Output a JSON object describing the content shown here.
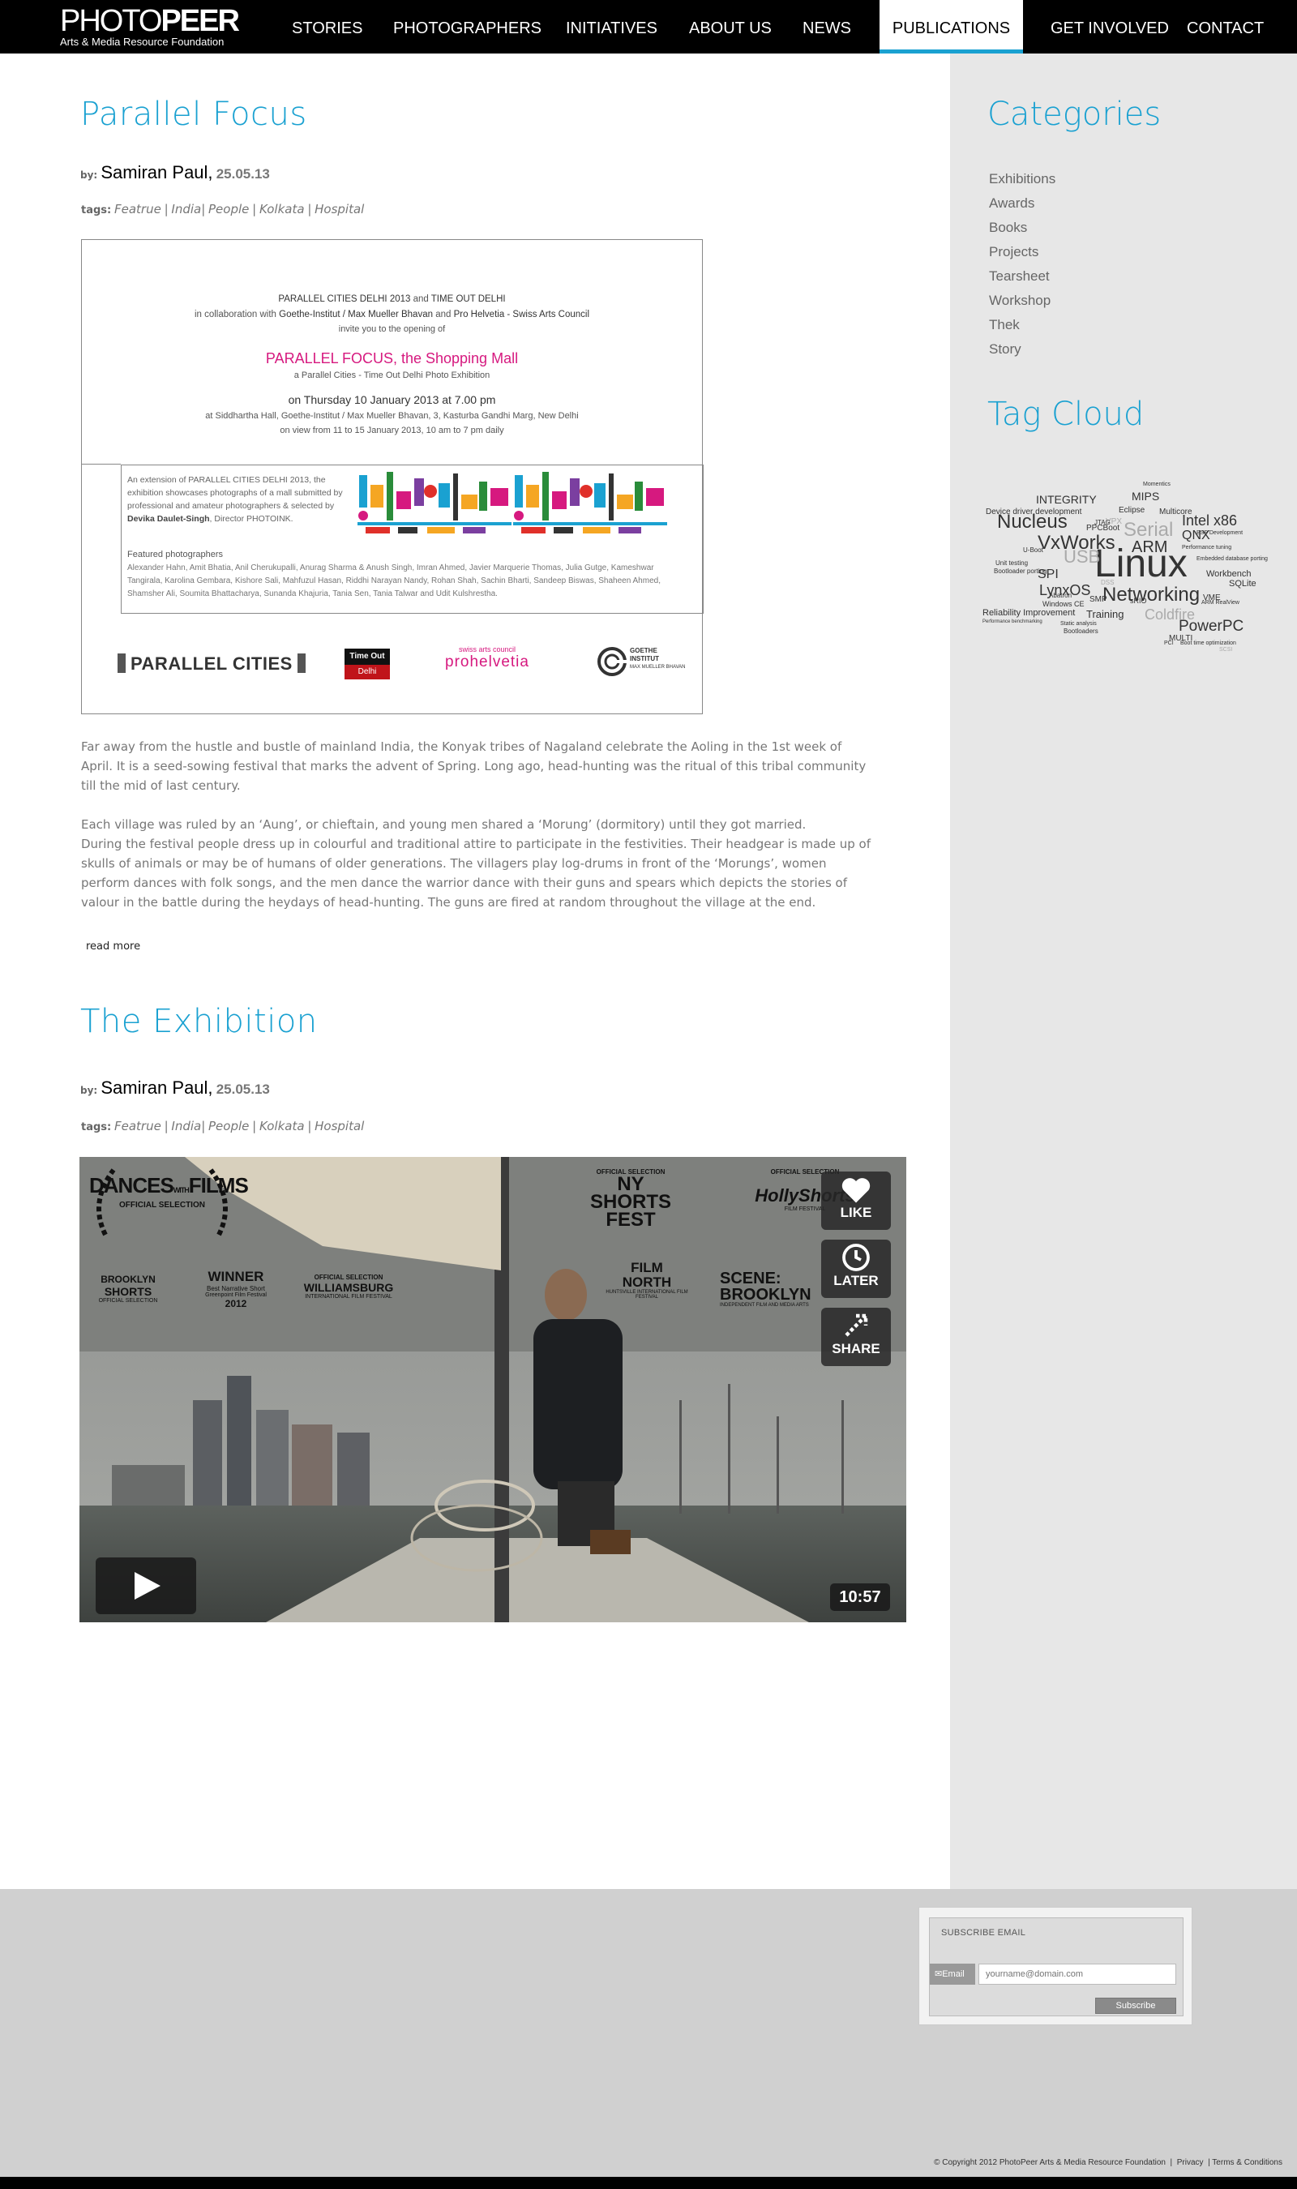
{
  "header": {
    "logo_main_thin": "PHOTO",
    "logo_main_bold": "PEER",
    "logo_sub": "Arts & Media Resource Foundation",
    "nav": [
      "STORIES",
      "PHOTOGRAPHERS",
      "INITIATIVES",
      "ABOUT US",
      "NEWS",
      "PUBLICATIONS",
      "GET INVOLVED",
      "CONTACT"
    ],
    "active_nav": "PUBLICATIONS",
    "accent_color": "#1aa1d1"
  },
  "posts": [
    {
      "title": "Parallel Focus",
      "by_label": "by:",
      "author": "Samiran Paul,",
      "date": "25.05.13",
      "tags_label": "tags:",
      "tags": [
        "Featrue",
        "India",
        "People",
        "Kolkata",
        "Hospital"
      ],
      "invite": {
        "line1a": "PARALLEL CITIES DELHI 2013",
        "line1b": " and ",
        "line1c": "TIME OUT DELHI",
        "line2a": "in collaboration with ",
        "line2b": "Goethe-Institut / Max Mueller Bhavan",
        "line2c": " and ",
        "line2d": "Pro Helvetia - Swiss Arts Council",
        "line3": "invite you to the opening of",
        "headline": "PARALLEL FOCUS, the Shopping Mall",
        "subheadline": "a Parallel Cities - Time Out Delhi Photo Exhibition",
        "when": "on Thursday 10 January 2013 at 7.00 pm",
        "where": "at Siddhartha Hall, Goethe-Institut / Max Mueller Bhavan, 3, Kasturba Gandhi Marg, New Delhi",
        "view": "on view from 11 to 15 January 2013, 10 am to 7 pm daily",
        "extension_a": "An extension of PARALLEL CITIES DELHI 2013, the exhibition showcases photographs of a mall submitted by professional and amateur photographers & selected by ",
        "extension_b": "Devika Daulet-Singh",
        "extension_c": ", Director PHOTOINK.",
        "featured_title": "Featured photographers",
        "featured_list": "Alexander Hahn, Amit Bhatia, Anil Cherukupalli, Anurag Sharma & Anush Singh, Imran Ahmed, Javier Marquerie Thomas, Julia Gutge, Kameshwar Tangirala, Karolina Gembara, Kishore Sali, Mahfuzul Hasan, Riddhi Narayan Nandy, Rohan Shah, Sachin Bharti, Sandeep Biswas, Shaheen Ahmed, Shamsher Ali, Soumita Bhattacharya, Sunanda Khajuria, Tania Sen, Tania Talwar and Udit Kulshrestha.",
        "logo_parallel": "PARALLEL CITIES",
        "logo_timeout_a": "Time Out",
        "logo_timeout_b": "Delhi",
        "logo_swiss": "swiss arts council",
        "logo_prohelvetia": "prohelvetia",
        "logo_goethe_a": "GOETHE",
        "logo_goethe_b": "INSTITUT",
        "logo_goethe_c": "MAX MUELLER BHAVAN"
      },
      "paragraphs": [
        "Far away from the hustle and bustle of mainland India, the Konyak tribes of Nagaland celebrate the Aoling in the 1st week of April. It is a seed-sowing festival that marks the advent of Spring. Long ago, head-hunting was the ritual of this tribal community till the mid of last century.",
        "Each village was ruled by an ‘Aung’, or chieftain, and young men shared a ‘Morung’ (dormitory) until they got married.",
        "During the festival people dress up in colourful and traditional attire to participate in the festivities. Their headgear is made up of skulls of animals or may be of humans of older generations. The villagers play log-drums in front of the ‘Morungs’, women perform dances with folk songs, and the men dance the warrior dance with their guns and spears which depicts the stories of valour in the battle during the heydays of head-hunting. The guns are fired at random throughout the village at the end."
      ],
      "read_more": "read more"
    },
    {
      "title": "The Exhibition",
      "by_label": "by:",
      "author": "Samiran Paul,",
      "date": "25.05.13",
      "tags_label": "tags:",
      "tags": [
        "Featrue",
        "India",
        "People",
        "Kolkata",
        "Hospital"
      ],
      "video": {
        "duration": "10:57",
        "like": "LIKE",
        "later": "LATER",
        "share": "SHARE",
        "laurels": {
          "dances_a": "DANCES",
          "dances_with": "WITH",
          "dances_b": "FILMS",
          "dances_c": "OFFICIAL SELECTION",
          "nyshorts_top": "OFFICIAL SELECTION",
          "nyshorts_a": "NY",
          "nyshorts_b": "SHORTS",
          "nyshorts_c": "FEST",
          "holly_top": "OFFICIAL SELECTION",
          "holly": "HollyShorts",
          "holly_sub": "FILM FESTIVAL",
          "brooklyn_a": "BROOKLYN",
          "brooklyn_b": "SHORTS",
          "brooklyn_c": "OFFICIAL SELECTION",
          "winner": "WINNER",
          "winner_b": "Best Narrative Short",
          "winner_c": "Greenpoint Film Festival",
          "winner_d": "2012",
          "wburg_a": "OFFICIAL SELECTION",
          "wburg_b": "WILLIAMSBURG",
          "wburg_c": "INTERNATIONAL FILM FESTIVAL",
          "filmnorth_a": "FILM",
          "filmnorth_b": "NORTH",
          "filmnorth_c": "HUNTSVILLE INTERNATIONAL FILM FESTIVAL",
          "scene_a": "SCENE:",
          "scene_b": "BROOKLYN",
          "scene_c": "INDEPENDENT FILM AND MEDIA ARTS"
        }
      }
    }
  ],
  "sidebar": {
    "categories_title": "Categories",
    "categories": [
      "Exhibitions",
      "Awards",
      "Books",
      "Projects",
      "Tearsheet",
      "Workshop",
      "Thek",
      "Story"
    ],
    "tagcloud_title": "Tag Cloud",
    "tagcloud": [
      "Linux",
      "Networking",
      "Nucleus",
      "VxWorks",
      "USB",
      "Serial",
      "ARM",
      "Intel x86",
      "QNX",
      "PowerPC",
      "LynxOS",
      "SPI",
      "Coldfire",
      "MIPS",
      "INTEGRITY",
      "Training",
      "Device driver development",
      "Eclipse",
      "Multicore",
      "PPCBoot",
      "Workbench",
      "SQLite",
      "VME",
      "Reliability Improvement",
      "SMP",
      "Windows CE",
      "MULTI",
      "Bootloaders",
      "Unit testing",
      "Bootloader porting",
      "Performance tuning",
      "Embedded database porting",
      "BSP Development",
      "U-Boot",
      "Abatron",
      "sRIO",
      "ARM RealView",
      "Boot time optimization",
      "Performance benchmarking",
      "Static analysis",
      "Momentics",
      "VPX",
      "JTAG",
      "DSS",
      "PCI",
      "SCSI"
    ]
  },
  "footer": {
    "subscribe_title": "SUBSCRIBE EMAIL",
    "email_label": "Email",
    "email_placeholder": "yourname@domain.com",
    "subscribe_button": "Subscribe",
    "copyright": "© Copyright 2012 PhotoPeer Arts & Media Resource Foundation",
    "privacy": "Privacy",
    "terms": "Terms & Conditions",
    "sep": "|"
  }
}
